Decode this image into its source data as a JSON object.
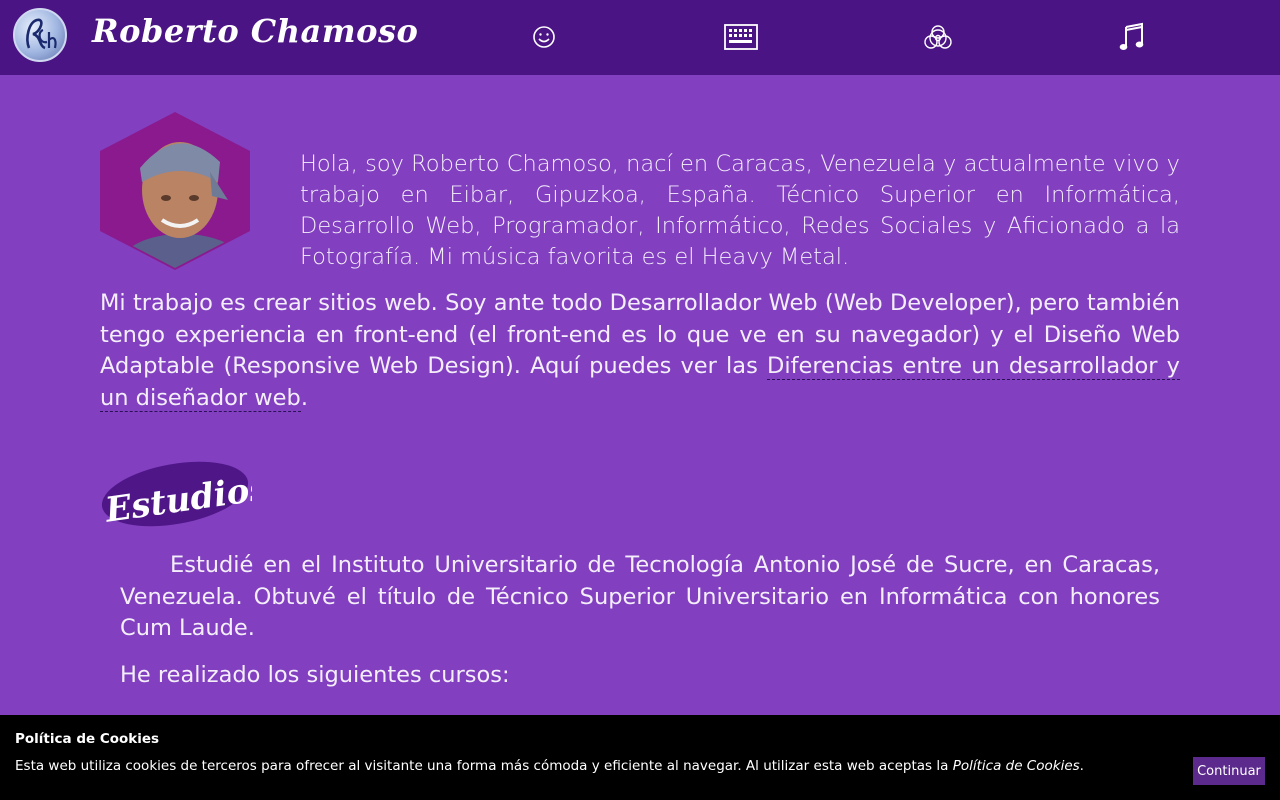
{
  "header": {
    "brand": "Roberto Chamoso",
    "nav": [
      {
        "icon": "smiley-icon"
      },
      {
        "icon": "keyboard-icon"
      },
      {
        "icon": "biohazard-icon"
      },
      {
        "icon": "music-note-icon"
      }
    ]
  },
  "intro": {
    "text": "Hola, soy Roberto Chamoso, nací en Caracas, Venezuela y actualmente vivo y trabajo en Eibar, Gipuzkoa, España. Técnico Superior en Informática, Desarrollo Web, Programador, Informático, Redes Sociales y Aficionado a la Fotografía. Mi música favorita es el Heavy Metal."
  },
  "work": {
    "text_before_link": "Mi trabajo es crear sitios web. Soy ante todo Desarrollador Web (Web Developer), pero también tengo experiencia en front-end (el front-end es lo que ve en su navegador) y el Diseño Web Adaptable (Responsive Web Design). Aquí puedes ver las ",
    "link_text": "Diferencias entre un desarrollador y un diseñador web",
    "text_after_link": "."
  },
  "studies": {
    "heading": "Estudios",
    "text": "Estudié en el Instituto Universitario de Tecnología Antonio José de Sucre, en Caracas, Venezuela. Obtuvé el título de Técnico Superior Universitario en Informática con honores Cum Laude.",
    "courses_intro": "He realizado los siguientes cursos:"
  },
  "cookies": {
    "title": "Política de Cookies",
    "text_before": "Esta web utiliza cookies de terceros para ofrecer al visitante una forma más cómoda y eficiente al navegar. Al utilizar esta web aceptas la ",
    "policy_link": "Política de Cookies",
    "text_after": ".",
    "button": "Continuar"
  },
  "colors": {
    "background": "#823fc0",
    "header": "#4b1484",
    "avatar_frame": "#8a1a8e",
    "estudios_badge": "#4e1686",
    "cookie_bar": "#000000",
    "cookie_button": "#5b2a8c"
  }
}
